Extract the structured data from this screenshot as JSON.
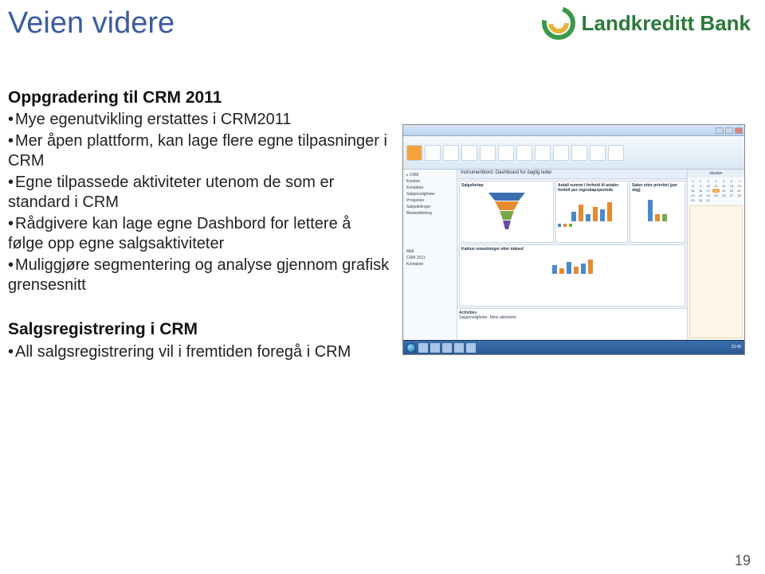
{
  "title": "Veien videre",
  "brand": {
    "name": "Landkreditt Bank"
  },
  "section1": {
    "heading": "Oppgradering til CRM 2011",
    "bullets": [
      "Mye egenutvikling erstattes i CRM2011",
      "Mer åpen plattform, kan lage flere egne tilpasninger i CRM",
      "Egne tilpassede aktiviteter utenom de som er standard i CRM",
      "Rådgivere kan lage egne Dashbord for lettere å følge opp egne salgsaktiviteter",
      "Muliggjøre segmentering og analyse gjennom grafisk grensesnitt"
    ]
  },
  "section2": {
    "heading": "Salgsregistrering i CRM",
    "bullets": [
      "All salgsregistrering vil i fremtiden foregå i CRM"
    ]
  },
  "screenshot": {
    "app_hint": "Microsoft Outlook / Dynamics CRM 2011",
    "dashboard_title": "Instrumentbord: Dashboard for daglig leder",
    "nav_items": [
      "CRM",
      "Kontoer",
      "Kontakter",
      "Salgsmuligheter",
      "Prosjekter",
      "Salgsdelinger",
      "Markedsføring",
      "Mail",
      "CRM 2011",
      "Kontakter"
    ],
    "widgets": {
      "funnel": {
        "title": "Salgsforløp"
      },
      "bars1": {
        "title": "Antall vunnet i forhold til avtaler fordelt per regnskapsperiode"
      },
      "bars2": {
        "title": "Saker etter prioritet (per dag)"
      },
      "chart_bottom": {
        "title": "Kaktus omsetninger etter måned"
      }
    },
    "activities_label": "Activities",
    "activities_sub": "Salgsmuligheter: Mine aktiviteter",
    "calendar_month": "oktober",
    "taskbar_time": "23:45"
  },
  "page_number": "19"
}
